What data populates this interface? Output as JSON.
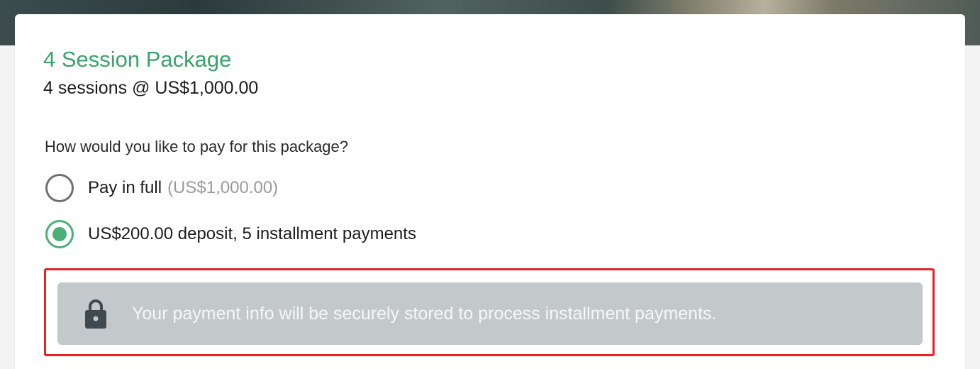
{
  "package": {
    "title": "4 Session Package",
    "subtitle": "4 sessions @ US$1,000.00"
  },
  "payment": {
    "question": "How would you like to pay for this package?",
    "options": [
      {
        "label": "Pay in full",
        "note": "(US$1,000.00)",
        "selected": false
      },
      {
        "label": "US$200.00 deposit, 5 installment payments",
        "note": "",
        "selected": true
      }
    ]
  },
  "notice": {
    "icon": "lock-icon",
    "text": "Your payment info will be securely stored to process installment payments."
  },
  "colors": {
    "accent_green": "#3aa36b",
    "radio_selected": "#4caf77",
    "notice_background": "#c3c8ca",
    "highlight_border": "#e62222"
  }
}
